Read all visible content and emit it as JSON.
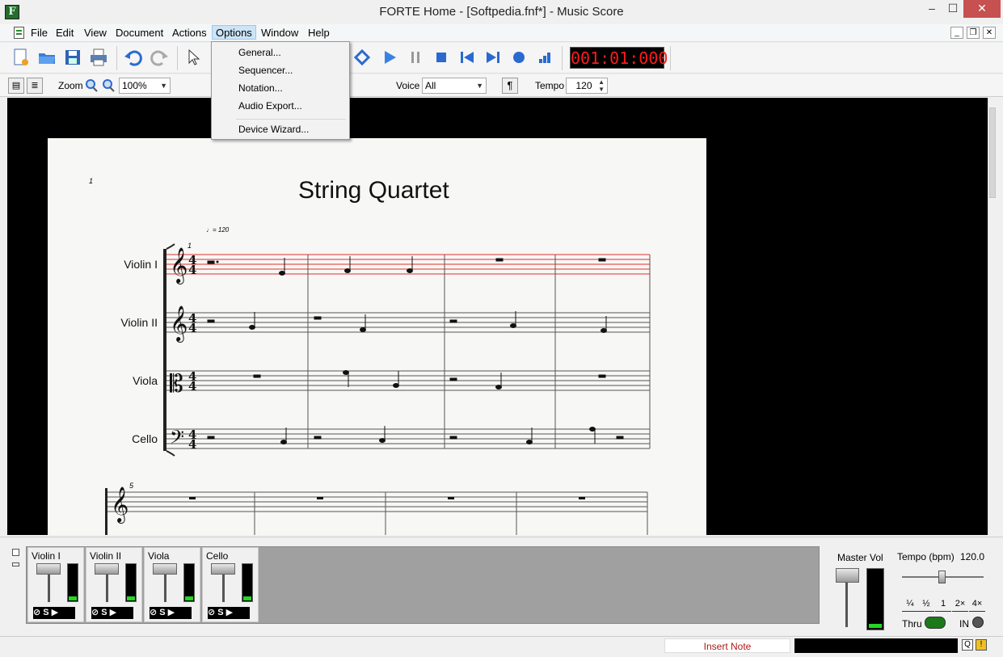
{
  "window": {
    "title": "FORTE Home - [Softpedia.fnf*] - Music Score",
    "minimize": "–",
    "maximize": "☐",
    "close": "✕"
  },
  "menubar": {
    "items": [
      "File",
      "Edit",
      "View",
      "Document",
      "Actions",
      "Options",
      "Window",
      "Help"
    ],
    "active": "Options"
  },
  "options_menu": {
    "items": [
      "General...",
      "Sequencer...",
      "Notation...",
      "Audio Export...",
      "Device Wizard..."
    ]
  },
  "toolbar": {
    "time": "001:01:000"
  },
  "toolbar2": {
    "zoom_label": "Zoom",
    "zoom_value": "100%",
    "voice_label": "Voice",
    "voice_value": "All",
    "para_symbol": "¶",
    "tempo_label": "Tempo",
    "tempo_value": "120"
  },
  "score": {
    "page_number": "1",
    "title": "String Quartet",
    "tempo_mark": "♩= 120",
    "first_measure": "1",
    "second_system_measure": "5",
    "instruments": [
      "Violin I",
      "Violin II",
      "Viola",
      "Cello"
    ]
  },
  "mixer": {
    "channels": [
      {
        "name": "Violin I",
        "level": 0.1
      },
      {
        "name": "Violin II",
        "level": 0.1
      },
      {
        "name": "Viola",
        "level": 0.1
      },
      {
        "name": "Cello",
        "level": 0.1
      }
    ],
    "channel_buttons": "⊘ S ▶"
  },
  "master": {
    "label": "Master Vol",
    "tempo_label": "Tempo (bpm)",
    "tempo_value": "120.0",
    "speed_buttons": [
      "¼",
      "½",
      "1",
      "2×",
      "4×"
    ],
    "thru_label": "Thru",
    "in_label": "IN"
  },
  "statusbar": {
    "mode": "Insert Note"
  },
  "colors": {
    "time_display": "#ff1a1a",
    "active_staff": "#e03030",
    "meter": "#22d822",
    "thru_led": "#1a7a1a"
  }
}
